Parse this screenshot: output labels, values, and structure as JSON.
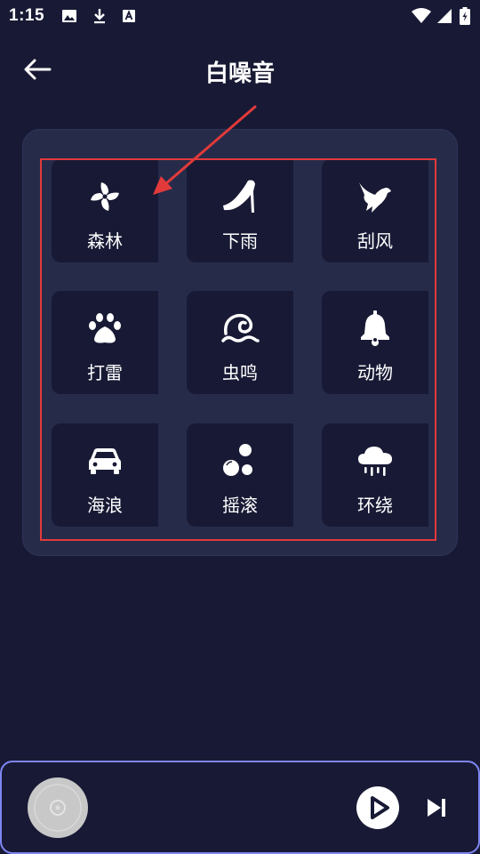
{
  "status_bar": {
    "time": "1:15",
    "left_icons": [
      "image-icon",
      "download-icon",
      "text-a-icon"
    ],
    "right_icons": [
      "wifi-icon",
      "signal-icon",
      "battery-icon"
    ]
  },
  "header": {
    "title": "白噪音",
    "back_icon": "arrow-left-icon"
  },
  "sounds": [
    {
      "label": "森林",
      "icon": "pinwheel-icon"
    },
    {
      "label": "下雨",
      "icon": "high-heel-icon"
    },
    {
      "label": "刮风",
      "icon": "dove-icon"
    },
    {
      "label": "打雷",
      "icon": "paw-icon"
    },
    {
      "label": "虫鸣",
      "icon": "wave-icon"
    },
    {
      "label": "动物",
      "icon": "bell-icon"
    },
    {
      "label": "海浪",
      "icon": "car-icon"
    },
    {
      "label": "摇滚",
      "icon": "bubbles-icon"
    },
    {
      "label": "环绕",
      "icon": "cloud-rain-icon"
    }
  ],
  "annotation": {
    "color": "#e23a3a",
    "type": "red arrow pointing to 森林 tile and red box around sound grid"
  },
  "player": {
    "cover_icon": "disc-icon",
    "play_icon": "play-icon",
    "next_icon": "skip-next-icon",
    "border_color": "#7e86f2"
  },
  "colors": {
    "background": "#181a35",
    "panel": "#272b4a",
    "text": "#ffffff"
  }
}
